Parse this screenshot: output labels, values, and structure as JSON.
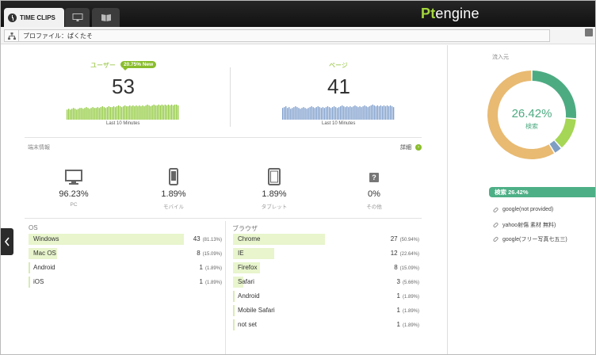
{
  "header": {
    "active_tab": "TIME CLIPS",
    "logo": {
      "prefix": "Pt",
      "suffix": "engine"
    }
  },
  "profile": {
    "text": "プロファイル：ぱくたそ"
  },
  "users": {
    "label": "ユーザー",
    "badge": "20.75% New",
    "value": "53",
    "caption": "Last 10 Minutes",
    "bars": [
      12,
      13,
      12,
      13,
      14,
      13,
      12,
      13,
      14,
      14,
      13,
      14,
      15,
      14,
      13,
      14,
      15,
      14,
      14,
      15,
      14,
      15,
      16,
      15,
      14,
      15,
      16,
      15,
      15,
      16,
      15,
      16,
      17,
      16,
      15,
      16,
      17,
      16,
      16,
      17,
      16,
      17,
      16,
      17,
      16,
      17,
      16,
      17,
      16,
      17,
      18,
      17,
      16,
      17,
      18,
      17,
      17,
      18,
      17,
      18,
      17,
      18,
      17,
      18,
      17,
      18,
      17,
      18,
      18,
      17
    ]
  },
  "pages": {
    "label": "ページ",
    "value": "41",
    "caption": "Last 10 Minutes",
    "bars": [
      14,
      15,
      16,
      14,
      15,
      13,
      14,
      15,
      16,
      15,
      14,
      13,
      14,
      15,
      14,
      13,
      14,
      15,
      16,
      15,
      14,
      15,
      16,
      15,
      14,
      15,
      14,
      15,
      16,
      15,
      14,
      15,
      16,
      15,
      14,
      15,
      16,
      17,
      16,
      15,
      16,
      15,
      16,
      15,
      16,
      17,
      16,
      15,
      16,
      15,
      16,
      17,
      16,
      15,
      16,
      17,
      18,
      17,
      16,
      17,
      16,
      17,
      16,
      17,
      16,
      17,
      16,
      17,
      16,
      15
    ]
  },
  "devices": {
    "title": "端末情報",
    "detail_label": "詳細",
    "detail_icon": "›",
    "items": [
      {
        "name": "PC",
        "pct": "96.23%",
        "icon": "monitor-icon"
      },
      {
        "name": "モバイル",
        "pct": "1.89%",
        "icon": "smartphone-icon"
      },
      {
        "name": "タブレット",
        "pct": "1.89%",
        "icon": "tablet-icon"
      },
      {
        "name": "その他",
        "pct": "0%",
        "icon": "question-icon",
        "glyph": "?"
      }
    ]
  },
  "os": {
    "title": "OS",
    "rows": [
      {
        "name": "Windows",
        "count": "43",
        "pct": "(81.13%)",
        "share": 0.8113
      },
      {
        "name": "Mac OS",
        "count": "8",
        "pct": "(15.09%)",
        "share": 0.1509
      },
      {
        "name": "Android",
        "count": "1",
        "pct": "(1.89%)",
        "share": 0.0189
      },
      {
        "name": "iOS",
        "count": "1",
        "pct": "(1.89%)",
        "share": 0.0189
      }
    ]
  },
  "browser": {
    "title": "ブラウザ",
    "rows": [
      {
        "name": "Chrome",
        "count": "27",
        "pct": "(50.94%)",
        "share": 0.5094
      },
      {
        "name": "IE",
        "count": "12",
        "pct": "(22.64%)",
        "share": 0.2264
      },
      {
        "name": "Firefox",
        "count": "8",
        "pct": "(15.09%)",
        "share": 0.1509
      },
      {
        "name": "Safari",
        "count": "3",
        "pct": "(5.66%)",
        "share": 0.0566
      },
      {
        "name": "Android",
        "count": "1",
        "pct": "(1.89%)",
        "share": 0.0189
      },
      {
        "name": "Mobile Safari",
        "count": "1",
        "pct": "(1.89%)",
        "share": 0.0189
      },
      {
        "name": "not set",
        "count": "1",
        "pct": "(1.89%)",
        "share": 0.0189
      }
    ]
  },
  "sources": {
    "title": "流入元",
    "center_pct": "26.42%",
    "center_label": "検索",
    "segments": [
      {
        "share": 0.2642,
        "color": "#4dab82"
      },
      {
        "share": 0.12,
        "color": "#a6d655"
      },
      {
        "share": 0.03,
        "color": "#7f9ec4"
      },
      {
        "share": 0.5858,
        "color": "#e8ba72"
      }
    ],
    "selected": "検索 26.42%",
    "items": [
      "google(not provided)",
      "yahoo射傷 素材 無料)",
      "google(フリー写真七五三)"
    ]
  },
  "colors": {
    "accent": "#8abd2c",
    "users_bars": "#8fc93a",
    "pages_bars": "#7b9ccb",
    "source_green": "#4dab82"
  }
}
